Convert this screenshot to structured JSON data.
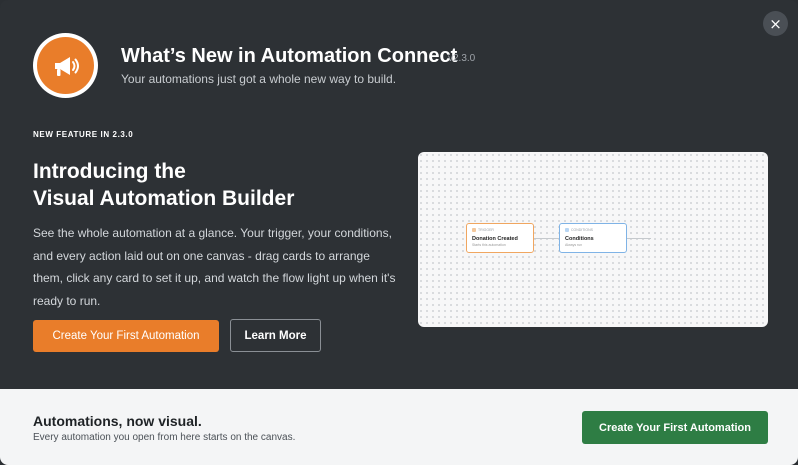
{
  "header": {
    "title": "What’s New in Automation Connect",
    "version": "v2.3.0",
    "subtitle": "Your automations just got a whole new way to build.",
    "close_label": "×",
    "logo_icon": "megaphone-icon",
    "logo_color": "#e97d2a"
  },
  "feature": {
    "tag": "NEW FEATURE IN 2.3.0",
    "headline_line1": "Introducing the",
    "headline_line2": "Visual Automation Builder",
    "description": "See the whole automation at a glance. Your trigger, your conditions, and every action laid out on one canvas - drag cards to arrange them, click any card to set it up, and watch the flow light up when it's ready to run.",
    "primary_button": "Create Your First Automation",
    "secondary_button": "Learn More"
  },
  "preview": {
    "nodes": [
      {
        "kind": "TRIGGER",
        "title": "Donation Created",
        "subtitle": "Starts this automation"
      },
      {
        "kind": "CONDITIONS",
        "title": "Conditions",
        "subtitle": "Always run"
      }
    ]
  },
  "footer": {
    "title": "Automations, now visual.",
    "subtitle": "Every automation you open from here starts on the canvas.",
    "button": "Create Your First Automation",
    "button_color": "#2e7d44"
  }
}
